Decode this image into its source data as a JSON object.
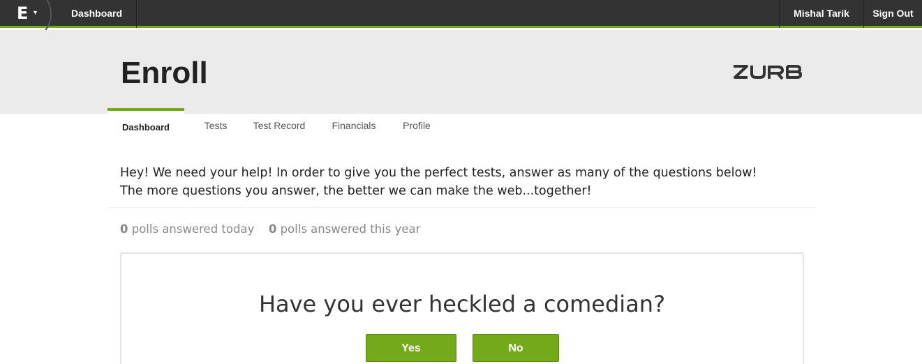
{
  "topbar": {
    "brand_letter": "E",
    "brand_caret": "▾",
    "dashboard_label": "Dashboard",
    "user_name": "Mishal Tarik",
    "signout_label": "Sign Out"
  },
  "header": {
    "title": "Enroll",
    "logo": "ZURB"
  },
  "tabs": [
    {
      "label": "Dashboard",
      "active": true
    },
    {
      "label": "Tests",
      "active": false
    },
    {
      "label": "Test Record",
      "active": false
    },
    {
      "label": "Financials",
      "active": false
    },
    {
      "label": "Profile",
      "active": false
    }
  ],
  "intro": {
    "line1": "Hey! We need your help! In order to give you the perfect tests, answer as many of the questions below!",
    "line2": "The more questions you answer, the better we can make the web...together!"
  },
  "stats": {
    "today_count": "0",
    "today_label": "polls answered today",
    "year_count": "0",
    "year_label": "polls answered this year"
  },
  "poll": {
    "question": "Have you ever heckled a comedian?",
    "yes_label": "Yes",
    "no_label": "No"
  },
  "colors": {
    "topbar": "#333333",
    "accent": "#74a91a",
    "header_bg": "#ebebeb"
  }
}
